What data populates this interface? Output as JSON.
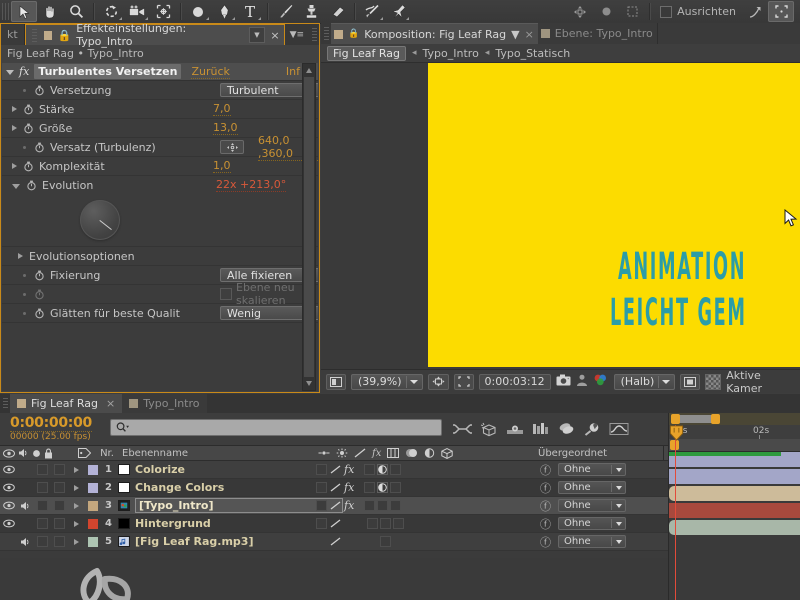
{
  "toolbar": {
    "tools": [
      {
        "name": "selection-tool",
        "glyph": "arrow",
        "selected": true
      },
      {
        "name": "hand-tool",
        "glyph": "hand",
        "selected": false
      },
      {
        "name": "zoom-tool",
        "glyph": "magnifier",
        "selected": false
      },
      {
        "name": "rotation-tool",
        "glyph": "rotate",
        "selected": false
      },
      {
        "name": "camera-tool",
        "glyph": "camera",
        "selected": false
      },
      {
        "name": "pan-behind-tool",
        "glyph": "anchor",
        "selected": false
      },
      {
        "name": "shape-tool",
        "glyph": "ellipse",
        "selected": false
      },
      {
        "name": "pen-tool",
        "glyph": "pen",
        "selected": false
      },
      {
        "name": "type-tool",
        "glyph": "T",
        "selected": false
      },
      {
        "name": "brush-tool",
        "glyph": "brush",
        "selected": false
      },
      {
        "name": "clone-stamp-tool",
        "glyph": "stamp",
        "selected": false
      },
      {
        "name": "eraser-tool",
        "glyph": "eraser",
        "selected": false
      },
      {
        "name": "roto-brush-tool",
        "glyph": "roto",
        "selected": false
      },
      {
        "name": "puppet-pin-tool",
        "glyph": "pin",
        "selected": false
      }
    ],
    "align_label": "Ausrichten",
    "align_checked": false
  },
  "effects_panel": {
    "left_stub_tab": "kt",
    "tab_title": "Effekteinstellungen: Typo_Intro",
    "close_label": "×",
    "breadcrumb": "Fig Leaf Rag • Typo_Intro",
    "effect": {
      "name": "Turbulentes Versetzen",
      "reset_label": "Zurück",
      "info_label": "Inf",
      "fx_badge": "fx"
    },
    "properties": [
      {
        "label": "Versetzung",
        "type": "dropdown",
        "value": "Turbulent",
        "tri": "none"
      },
      {
        "label": "Stärke",
        "type": "number",
        "value": "7,0",
        "tri": "closed"
      },
      {
        "label": "Größe",
        "type": "number",
        "value": "13,0",
        "tri": "closed"
      },
      {
        "label": "Versatz (Turbulenz)",
        "type": "point",
        "value": "640,0 ,360,0",
        "tri": "none"
      },
      {
        "label": "Komplexität",
        "type": "number",
        "value": "1,0",
        "tri": "closed"
      },
      {
        "label": "Evolution",
        "type": "angle",
        "value": "22x +213,0°",
        "tri": "open"
      }
    ],
    "evolution_options_label": "Evolutionsoptionen",
    "properties2": [
      {
        "label": "Fixierung",
        "type": "dropdown",
        "value": "Alle fixieren"
      },
      {
        "label": "",
        "type": "checkbox",
        "value": "Ebene neu skalieren",
        "checked": false
      },
      {
        "label": "Glätten für beste Qualit",
        "type": "dropdown",
        "value": "Wenig"
      }
    ]
  },
  "composition_panel": {
    "tab_title": "Komposition: Fig Leaf Rag",
    "tab_secondary": "Ebene: Typo_Intro",
    "close_label": "×",
    "breadcrumb": [
      {
        "label": "Fig Leaf Rag",
        "active": true
      },
      {
        "label": "Typo_Intro",
        "active": false
      },
      {
        "label": "Typo_Statisch",
        "active": false
      }
    ],
    "stage": {
      "background_color": "#FCDC00",
      "text_color": "#2b9da8",
      "line1": "ANIMATION",
      "line2": "LEICHT GEM"
    },
    "bottom_bar": {
      "zoom": "(39,9%)",
      "time": "0:00:03:12",
      "quality": "(Halb)",
      "camera": "Aktive Kamer"
    }
  },
  "timeline_panel": {
    "tabs": [
      {
        "label": "Fig Leaf Rag",
        "active": true,
        "closable": true
      },
      {
        "label": "Typo_Intro",
        "active": false,
        "closable": false
      }
    ],
    "current_time": "0:00:00:00",
    "frames_fps": "00000 (25.00 fps)",
    "search_placeholder": "",
    "columns": {
      "number": "Nr.",
      "layer_name": "Ebenenname",
      "parent": "Übergeordnet"
    },
    "layers": [
      {
        "num": "1",
        "name": "Colorize",
        "color": "#b3b2d6",
        "swatch": "#ffffff",
        "audio": false,
        "video": true,
        "selected": false,
        "fx": true,
        "parent": "Ohne",
        "bar_color": "#a3a6c8",
        "kind": "adjust"
      },
      {
        "num": "2",
        "name": "Change Colors",
        "color": "#b3b2d6",
        "swatch": "#ffffff",
        "audio": false,
        "video": true,
        "selected": false,
        "fx": true,
        "parent": "Ohne",
        "bar_color": "#a3a6c8",
        "kind": "adjust"
      },
      {
        "num": "3",
        "name": "[Typo_Intro]",
        "color": "#c4a77e",
        "swatch": "#2e8ab0",
        "audio": true,
        "video": true,
        "selected": true,
        "fx": true,
        "parent": "Ohne",
        "bar_color": "#cdbb9a",
        "kind": "comp"
      },
      {
        "num": "4",
        "name": "Hintergrund",
        "color": "#d2452e",
        "swatch": "#000000",
        "audio": false,
        "video": true,
        "selected": false,
        "fx": false,
        "parent": "Ohne",
        "bar_color": "#a8493d",
        "kind": "solid"
      },
      {
        "num": "5",
        "name": "[Fig Leaf Rag.mp3]",
        "color": "#adc4b2",
        "swatch": "#5f7fbf",
        "audio": true,
        "video": false,
        "selected": false,
        "fx": false,
        "parent": "Ohne",
        "bar_color": "#a8b7a8",
        "kind": "audio"
      }
    ],
    "ruler": {
      "labels": [
        {
          "text": "0s",
          "x": 6
        },
        {
          "text": "02s",
          "x": 84
        }
      ]
    }
  }
}
